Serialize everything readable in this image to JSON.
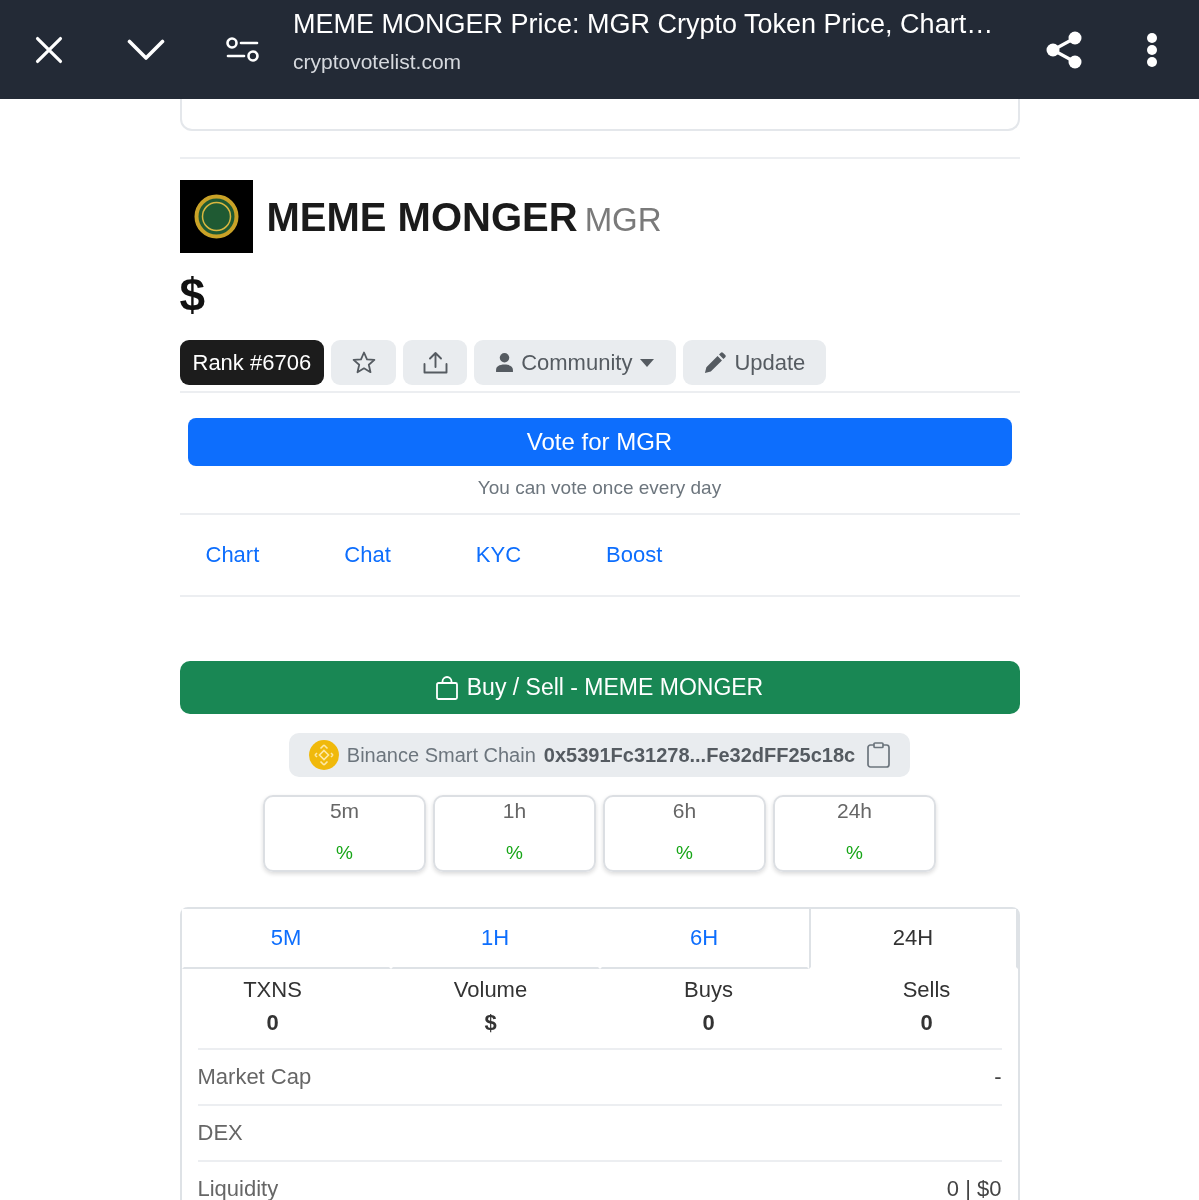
{
  "browser_bar": {
    "title": "MEME MONGER Price: MGR Crypto Token Price, Chart…",
    "url": "cryptovotelist.com"
  },
  "token": {
    "name": "MEME MONGER",
    "symbol": "MGR",
    "price": "$"
  },
  "actions": [
    {
      "kind": "rank",
      "label": "Rank #6706"
    },
    {
      "kind": "star"
    },
    {
      "kind": "share"
    },
    {
      "kind": "dropdown",
      "label": "Community"
    },
    {
      "kind": "edit",
      "label": "Update"
    }
  ],
  "vote": {
    "button": "Vote for MGR",
    "note": "You can vote once every day"
  },
  "links": [
    "Chart",
    "Chat",
    "KYC",
    "Boost"
  ],
  "buy_sell": {
    "label": "Buy / Sell - MEME MONGER"
  },
  "contract": {
    "chain": "Binance Smart Chain",
    "address": "0x5391Fc31278...Fe32dFF25c18c"
  },
  "price_changes": [
    {
      "period": "5m",
      "change": "%"
    },
    {
      "period": "1h",
      "change": "%"
    },
    {
      "period": "6h",
      "change": "%"
    },
    {
      "period": "24h",
      "change": "%"
    }
  ],
  "stats": {
    "tabs": [
      {
        "label": "5M",
        "selected": false
      },
      {
        "label": "1H",
        "selected": false
      },
      {
        "label": "6H",
        "selected": false
      },
      {
        "label": "24H",
        "selected": true
      }
    ],
    "columns": [
      {
        "label": "TXNS",
        "value": "0"
      },
      {
        "label": "Volume",
        "value": "$"
      },
      {
        "label": "Buys",
        "value": "0"
      },
      {
        "label": "Sells",
        "value": "0"
      }
    ],
    "rows": [
      {
        "label": "Market Cap",
        "value": "-"
      },
      {
        "label": "DEX"
      },
      {
        "label": "Liquidity",
        "value": "0 | $0"
      }
    ]
  }
}
